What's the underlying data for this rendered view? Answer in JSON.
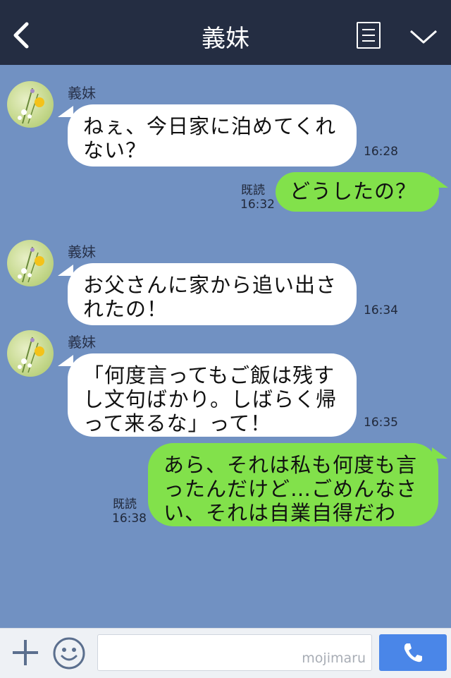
{
  "header": {
    "title": "義妹"
  },
  "messages": [
    {
      "sender": "義妹",
      "text": "ねぇ、今日家に泊めてくれ\nない？",
      "time": "16:28"
    },
    {
      "text": "どうしたの？",
      "read": "既読",
      "time": "16:32"
    },
    {
      "sender": "義妹",
      "text": "お父さんに家から追い出さ\nれたの！",
      "time": "16:34"
    },
    {
      "sender": "義妹",
      "text": "「何度言ってもご飯は残す\nし文句ばかり。しばらく帰\nって来るな」って！",
      "time": "16:35"
    },
    {
      "text": "あら、それは私も何度も言\nったんだけど…ごめんなさ\nい、それは自業自得だわ",
      "read": "既読",
      "time": "16:38"
    }
  ],
  "input": {
    "watermark": "mojimaru"
  },
  "colors": {
    "header": "#242d42",
    "chat_bg": "#7191c2",
    "outgoing": "#82e14b",
    "incoming": "#ffffff",
    "call_button": "#4a86e8"
  },
  "icons": {
    "back": "chevron-left-icon",
    "menu": "list-icon",
    "collapse": "chevron-down-icon",
    "plus": "plus-icon",
    "emoji": "smiley-icon",
    "call": "phone-icon"
  }
}
